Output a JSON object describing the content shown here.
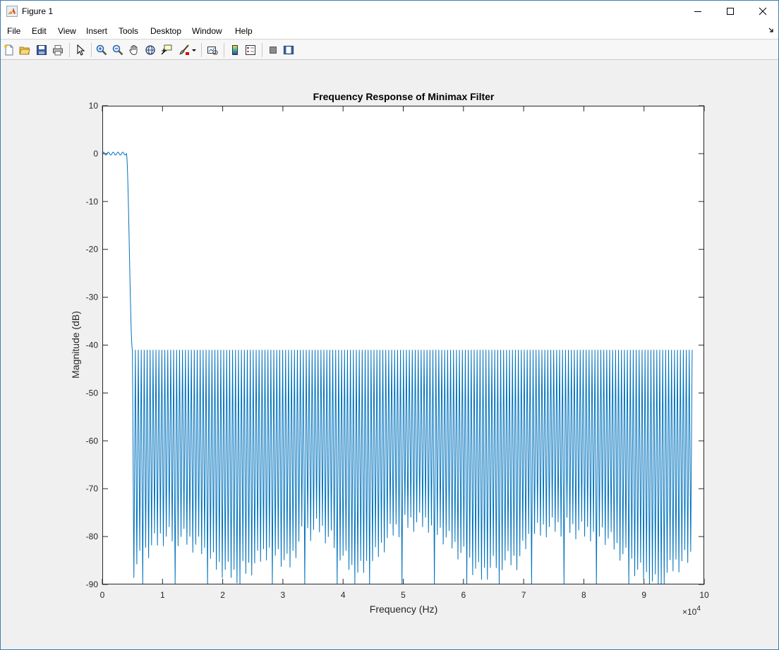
{
  "window": {
    "title": "Figure 1"
  },
  "menu": {
    "items": [
      "File",
      "Edit",
      "View",
      "Insert",
      "Tools",
      "Desktop",
      "Window",
      "Help"
    ]
  },
  "toolbar": {
    "icons": [
      "new-figure-icon",
      "open-file-icon",
      "save-icon",
      "print-icon",
      "pointer-icon",
      "zoom-in-icon",
      "zoom-out-icon",
      "pan-icon",
      "rotate-3d-icon",
      "data-cursor-icon",
      "brush-icon",
      "link-plot-icon",
      "colorbar-icon",
      "legend-icon",
      "hide-plot-tools-icon",
      "show-plot-tools-icon"
    ]
  },
  "colors": {
    "line": "#0072bd",
    "axes_bg": "#ffffff",
    "figure_bg": "#f0f0f0"
  },
  "chart_data": {
    "type": "line",
    "title": "Frequency Response of Minimax Filter",
    "xlabel": "Frequency (Hz)",
    "ylabel": "Magnitude (dB)",
    "x_exponent_label": "×10",
    "x_exponent_power": "4",
    "xlim": [
      0,
      10
    ],
    "ylim": [
      -90,
      10
    ],
    "x_units_scale": 10000,
    "xticks": [
      "0",
      "1",
      "2",
      "3",
      "4",
      "5",
      "6",
      "7",
      "8",
      "9",
      "10"
    ],
    "yticks": [
      "10",
      "0",
      "-10",
      "-20",
      "-30",
      "-40",
      "-50",
      "-60",
      "-70",
      "-80",
      "-90"
    ],
    "grid": false,
    "legend": "none",
    "passband": {
      "x_start": 0,
      "x_end": 0.4,
      "level_db": 0,
      "ripple_db": 0.3
    },
    "transition": {
      "x_start": 0.4,
      "x_end": 0.5
    },
    "stopband": {
      "x_start": 0.5,
      "x_end": 9.8,
      "peak_db": -41,
      "lobes": 190,
      "null_envelope_db": [
        [
          0.5,
          -87
        ],
        [
          0.8,
          -82
        ],
        [
          1.0,
          -80
        ],
        [
          1.3,
          -80
        ],
        [
          1.6,
          -82
        ],
        [
          1.9,
          -86
        ],
        [
          2.2,
          -88
        ],
        [
          2.5,
          -86
        ],
        [
          2.8,
          -82
        ],
        [
          3.1,
          -86
        ],
        [
          3.3,
          -80
        ],
        [
          3.6,
          -78
        ],
        [
          3.9,
          -82
        ],
        [
          4.2,
          -88
        ],
        [
          4.5,
          -85
        ],
        [
          4.8,
          -79
        ],
        [
          5.1,
          -77
        ],
        [
          5.4,
          -77
        ],
        [
          5.7,
          -80
        ],
        [
          6.0,
          -84
        ],
        [
          6.3,
          -88
        ],
        [
          6.6,
          -85
        ],
        [
          6.9,
          -85
        ],
        [
          7.1,
          -80
        ],
        [
          7.4,
          -78
        ],
        [
          7.7,
          -78
        ],
        [
          8.0,
          -79
        ],
        [
          8.3,
          -79
        ],
        [
          8.6,
          -83
        ],
        [
          8.9,
          -87
        ],
        [
          9.2,
          -90
        ],
        [
          9.5,
          -86
        ],
        [
          9.8,
          -84
        ]
      ]
    }
  }
}
